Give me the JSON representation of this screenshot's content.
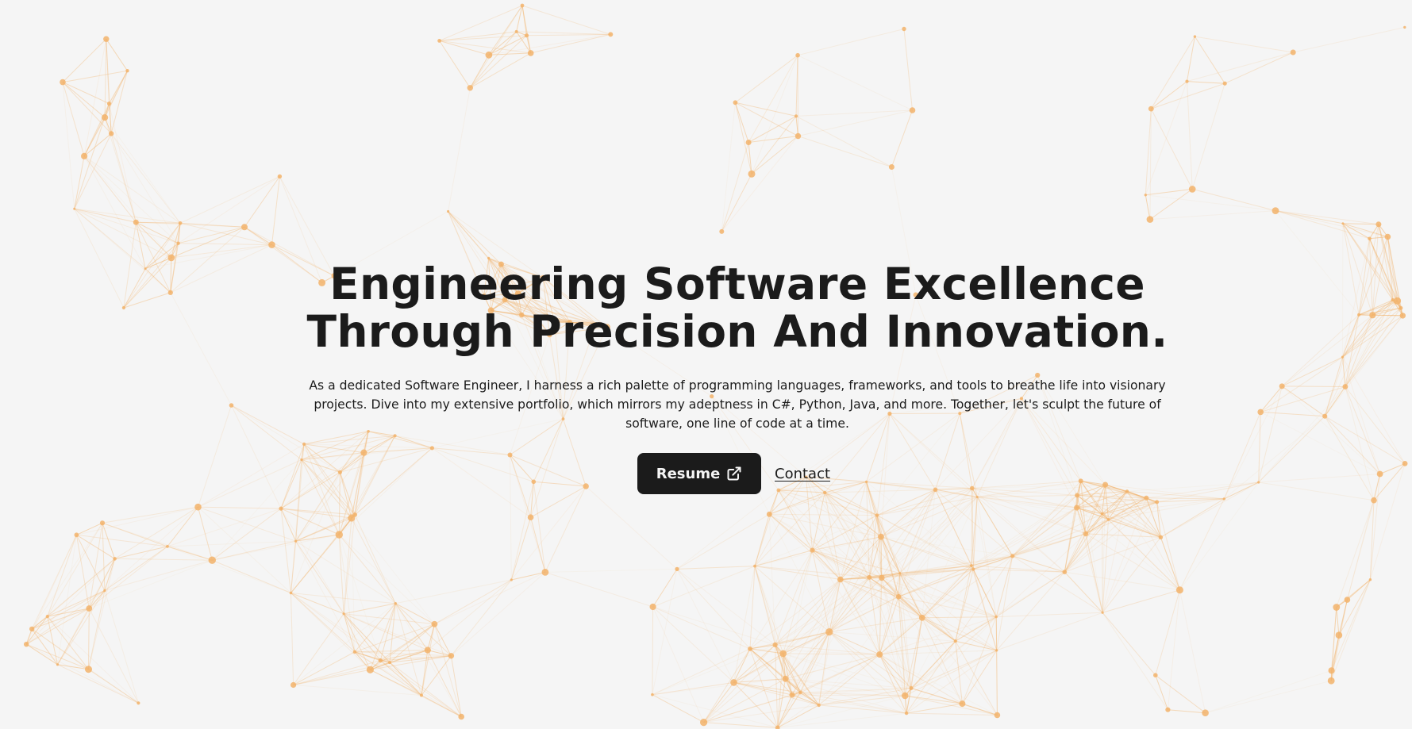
{
  "hero": {
    "title_line1": "Engineering Software Excellence",
    "title_line2": "Through Precision And Innovation.",
    "description": "As a dedicated Software Engineer, I harness a rich palette of programming languages, frameworks, and tools to breathe life into visionary projects. Dive into my extensive portfolio, which mirrors my adeptness in C#, Python, Java, and more. Together, let's sculpt the future of software, one line of code at a time."
  },
  "cta": {
    "resume_label": "Resume",
    "resume_icon": "external-link-icon",
    "contact_label": "Contact"
  },
  "colors": {
    "background": "#f5f5f5",
    "text": "#1b1b1b",
    "button_bg": "#1b1b1b",
    "button_text": "#f5f5f5",
    "network_accent": "#f2b36b"
  }
}
